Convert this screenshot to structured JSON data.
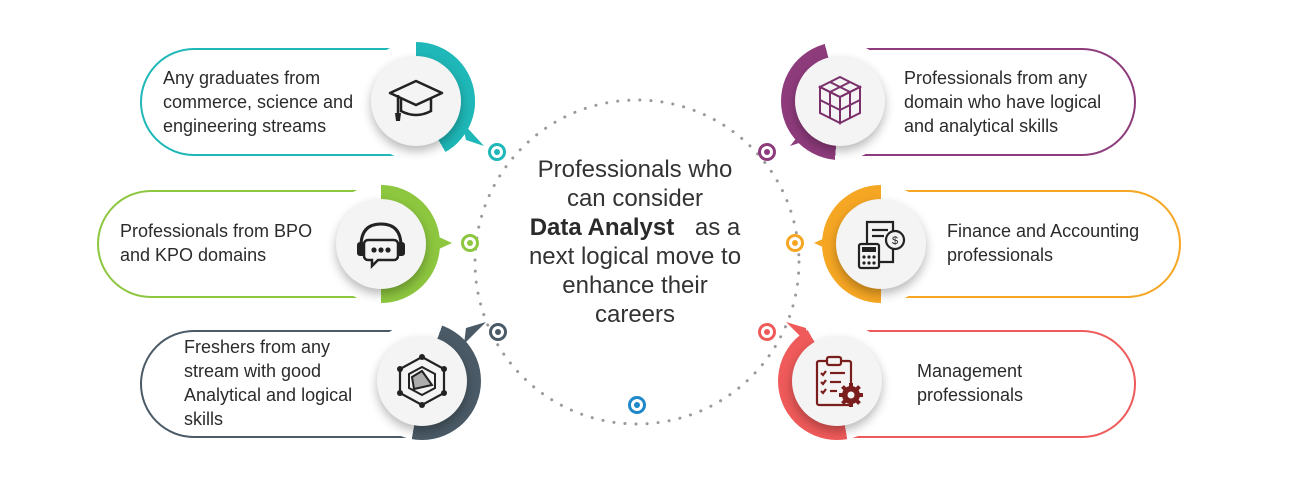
{
  "center": {
    "line1": "Professionals who",
    "line2": "can consider",
    "highlight": "Data Analyst",
    "line3_rest": "as a",
    "line4": "next logical move to",
    "line5": "enhance their",
    "line6": "careers"
  },
  "cards": {
    "graduates": {
      "lines": [
        "Any graduates from",
        "commerce, science and",
        "engineering streams"
      ],
      "color": "#1fb7b7"
    },
    "bpo": {
      "lines": [
        "Professionals from BPO",
        "and KPO domains"
      ],
      "color": "#8dc63f"
    },
    "freshers": {
      "lines": [
        "Freshers from any",
        "stream with good",
        "Analytical and logical",
        "skills"
      ],
      "color": "#4a5a66"
    },
    "domain": {
      "lines": [
        "Professionals from any",
        "domain who have logical",
        "and analytical skills"
      ],
      "color": "#8e3b7c"
    },
    "finance": {
      "lines": [
        "Finance and Accounting",
        "professionals"
      ],
      "color": "#f5a623"
    },
    "management": {
      "lines": [
        "Management",
        "professionals"
      ],
      "color": "#ef5a5a"
    }
  },
  "icons": {
    "graduates": "graduation-cap-icon",
    "bpo": "headset-chat-icon",
    "freshers": "analytics-network-icon",
    "domain": "cubes-icon",
    "finance": "calculator-invoice-icon",
    "management": "clipboard-gear-icon"
  },
  "connector_dot_color": "#1e88c8"
}
